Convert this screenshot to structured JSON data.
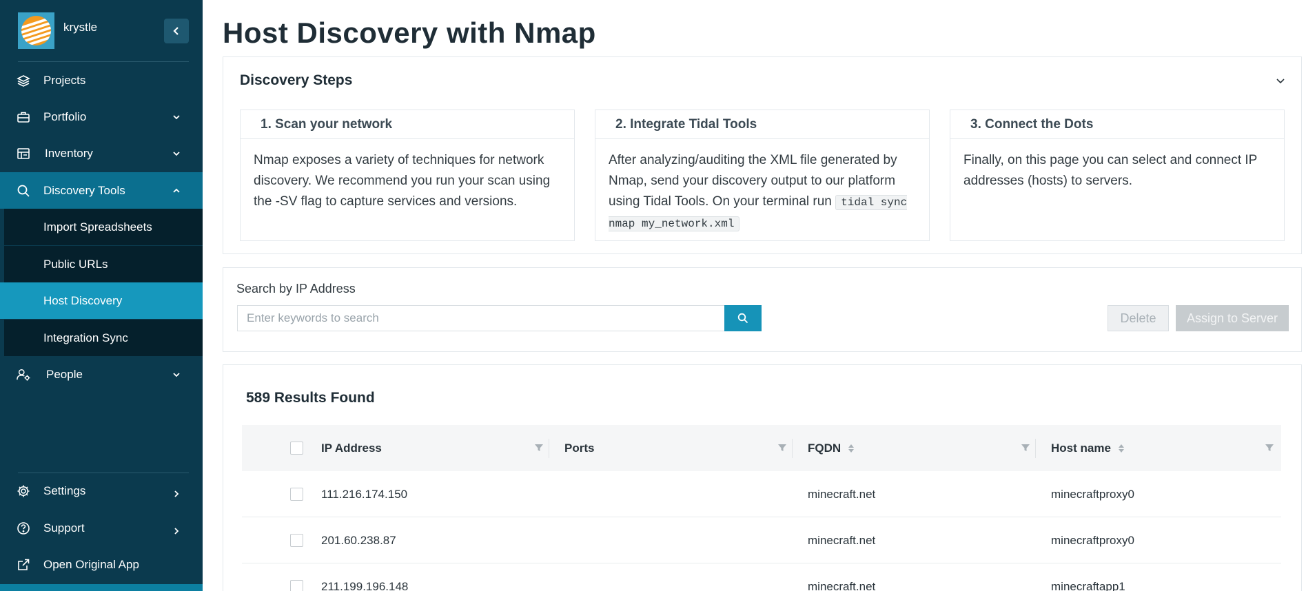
{
  "sidebar": {
    "username": "krystle",
    "nav": [
      {
        "label": "Projects",
        "icon": "layers-icon"
      },
      {
        "label": "Portfolio",
        "icon": "briefcase-icon"
      },
      {
        "label": "Inventory",
        "icon": "inventory-icon"
      },
      {
        "label": "Discovery Tools",
        "icon": "search-icon"
      }
    ],
    "discovery_sub": [
      {
        "label": "Import Spreadsheets"
      },
      {
        "label": "Public URLs"
      },
      {
        "label": "Host Discovery"
      },
      {
        "label": "Integration Sync"
      }
    ],
    "people": {
      "label": "People",
      "icon": "users-gear-icon"
    },
    "footer": [
      {
        "label": "Settings",
        "icon": "gear-icon"
      },
      {
        "label": "Support",
        "icon": "help-icon"
      },
      {
        "label": "Open Original App",
        "icon": "external-link-icon"
      }
    ],
    "colors": {
      "bg": "#0b3a4e",
      "active": "#0b6f8f",
      "selected": "#1698bd"
    }
  },
  "page": {
    "title": "Host Discovery with Nmap"
  },
  "steps": {
    "title": "Discovery Steps",
    "cards": [
      {
        "heading": "1. Scan your network",
        "body": "Nmap exposes a variety of techniques for network discovery. We recommend you run your scan using the -SV flag to capture services and versions."
      },
      {
        "heading": "2. Integrate Tidal Tools",
        "body": "After analyzing/auditing the XML file generated by Nmap, send your discovery output to our platform using Tidal Tools. On your terminal run",
        "code": "tidal sync nmap my_network.xml"
      },
      {
        "heading": "3. Connect the Dots",
        "body": "Finally, on this page you can select and connect IP addresses (hosts) to servers."
      }
    ]
  },
  "search": {
    "label": "Search by IP Address",
    "placeholder": "Enter keywords to search",
    "value": "",
    "delete_label": "Delete",
    "assign_label": "Assign to Server"
  },
  "results": {
    "count_label": "589 Results Found",
    "columns": [
      "IP Address",
      "Ports",
      "FQDN",
      "Host name"
    ],
    "rows": [
      {
        "ip": "111.216.174.150",
        "ports": "",
        "fqdn": "minecraft.net",
        "host": "minecraftproxy0"
      },
      {
        "ip": "201.60.238.87",
        "ports": "",
        "fqdn": "minecraft.net",
        "host": "minecraftproxy0"
      },
      {
        "ip": "211.199.196.148",
        "ports": "",
        "fqdn": "minecraft.net",
        "host": "minecraftapp1"
      }
    ]
  },
  "accent_color": "#1693b8"
}
